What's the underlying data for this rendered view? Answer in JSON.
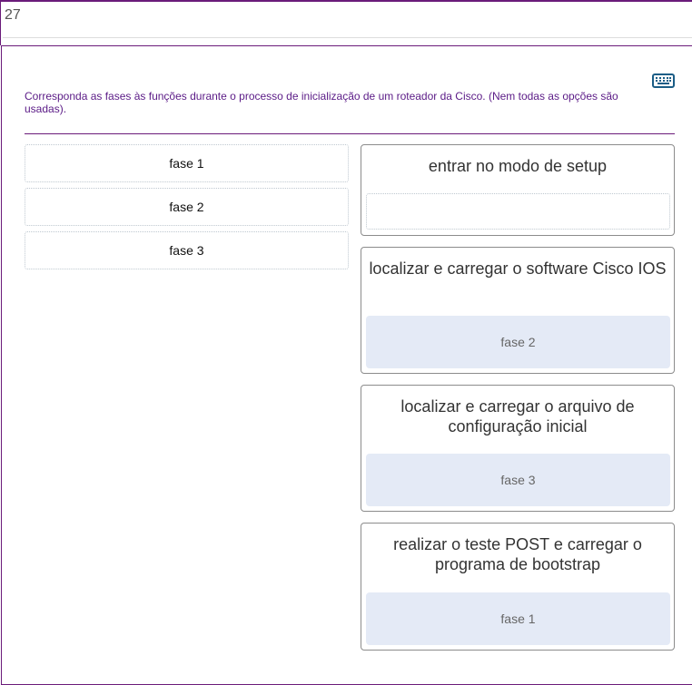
{
  "question": {
    "number": "27",
    "instruction": "Corresponda as fases às funções durante o processo de inicialização de um roteador da Cisco. (Nem todas as opções são usadas)."
  },
  "icons": {
    "keyboard": "keyboard-icon"
  },
  "colors": {
    "accent": "#6a1b7a",
    "instruction_text": "#5a1a86",
    "filled_drop": "#e4eaf6",
    "keyboard_icon": "#1b5d86"
  },
  "options": [
    {
      "label": "fase 1"
    },
    {
      "label": "fase 2"
    },
    {
      "label": "fase 3"
    }
  ],
  "targets": [
    {
      "label": "entrar no modo de setup",
      "answer": ""
    },
    {
      "label": "localizar e carregar o software Cisco IOS",
      "answer": "fase 2"
    },
    {
      "label": "localizar e carregar o arquivo de configuração inicial",
      "answer": "fase 3"
    },
    {
      "label": "realizar o teste POST e carregar o programa de bootstrap",
      "answer": "fase 1"
    }
  ]
}
